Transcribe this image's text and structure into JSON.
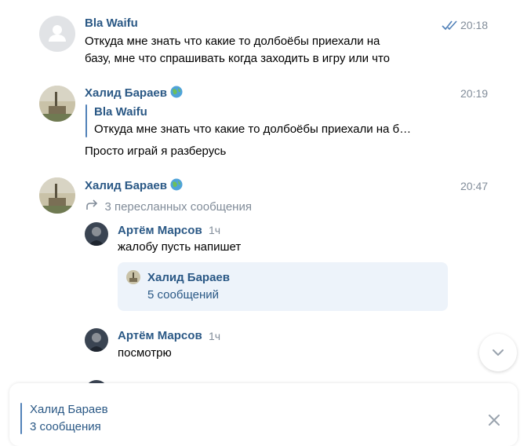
{
  "messages": [
    {
      "author": "Bla Waifu",
      "time": "20:18",
      "lines": [
        "Откуда мне знать что какие то долбоёбы приехали на",
        "базу, мне что спрашивать когда заходить в игру или что"
      ]
    },
    {
      "author": "Халид Бараев",
      "time": "20:19",
      "reply_author": "Bla Waifu",
      "reply_text": "Откуда мне знать что какие то долбоёбы приехали на б…",
      "text": "Просто играй я разберусь"
    },
    {
      "author": "Халид Бараев",
      "time": "20:47",
      "forwarded_label": "3 пересланных сообщения",
      "forwarded": [
        {
          "author": "Артём Марсов",
          "time": "1ч",
          "text": "жалобу пусть напишет",
          "card_author": "Халид Бараев",
          "card_count": "5 сообщений"
        },
        {
          "author": "Артём Марсов",
          "time": "1ч",
          "text": "посмотрю"
        }
      ]
    }
  ],
  "bottom_panel": {
    "author": "Халид Бараев",
    "subtitle": "3 сообщения"
  },
  "colors": {
    "link": "#2a5885",
    "accent": "#5181b8",
    "muted": "#818c99",
    "card": "#edf3fa"
  }
}
